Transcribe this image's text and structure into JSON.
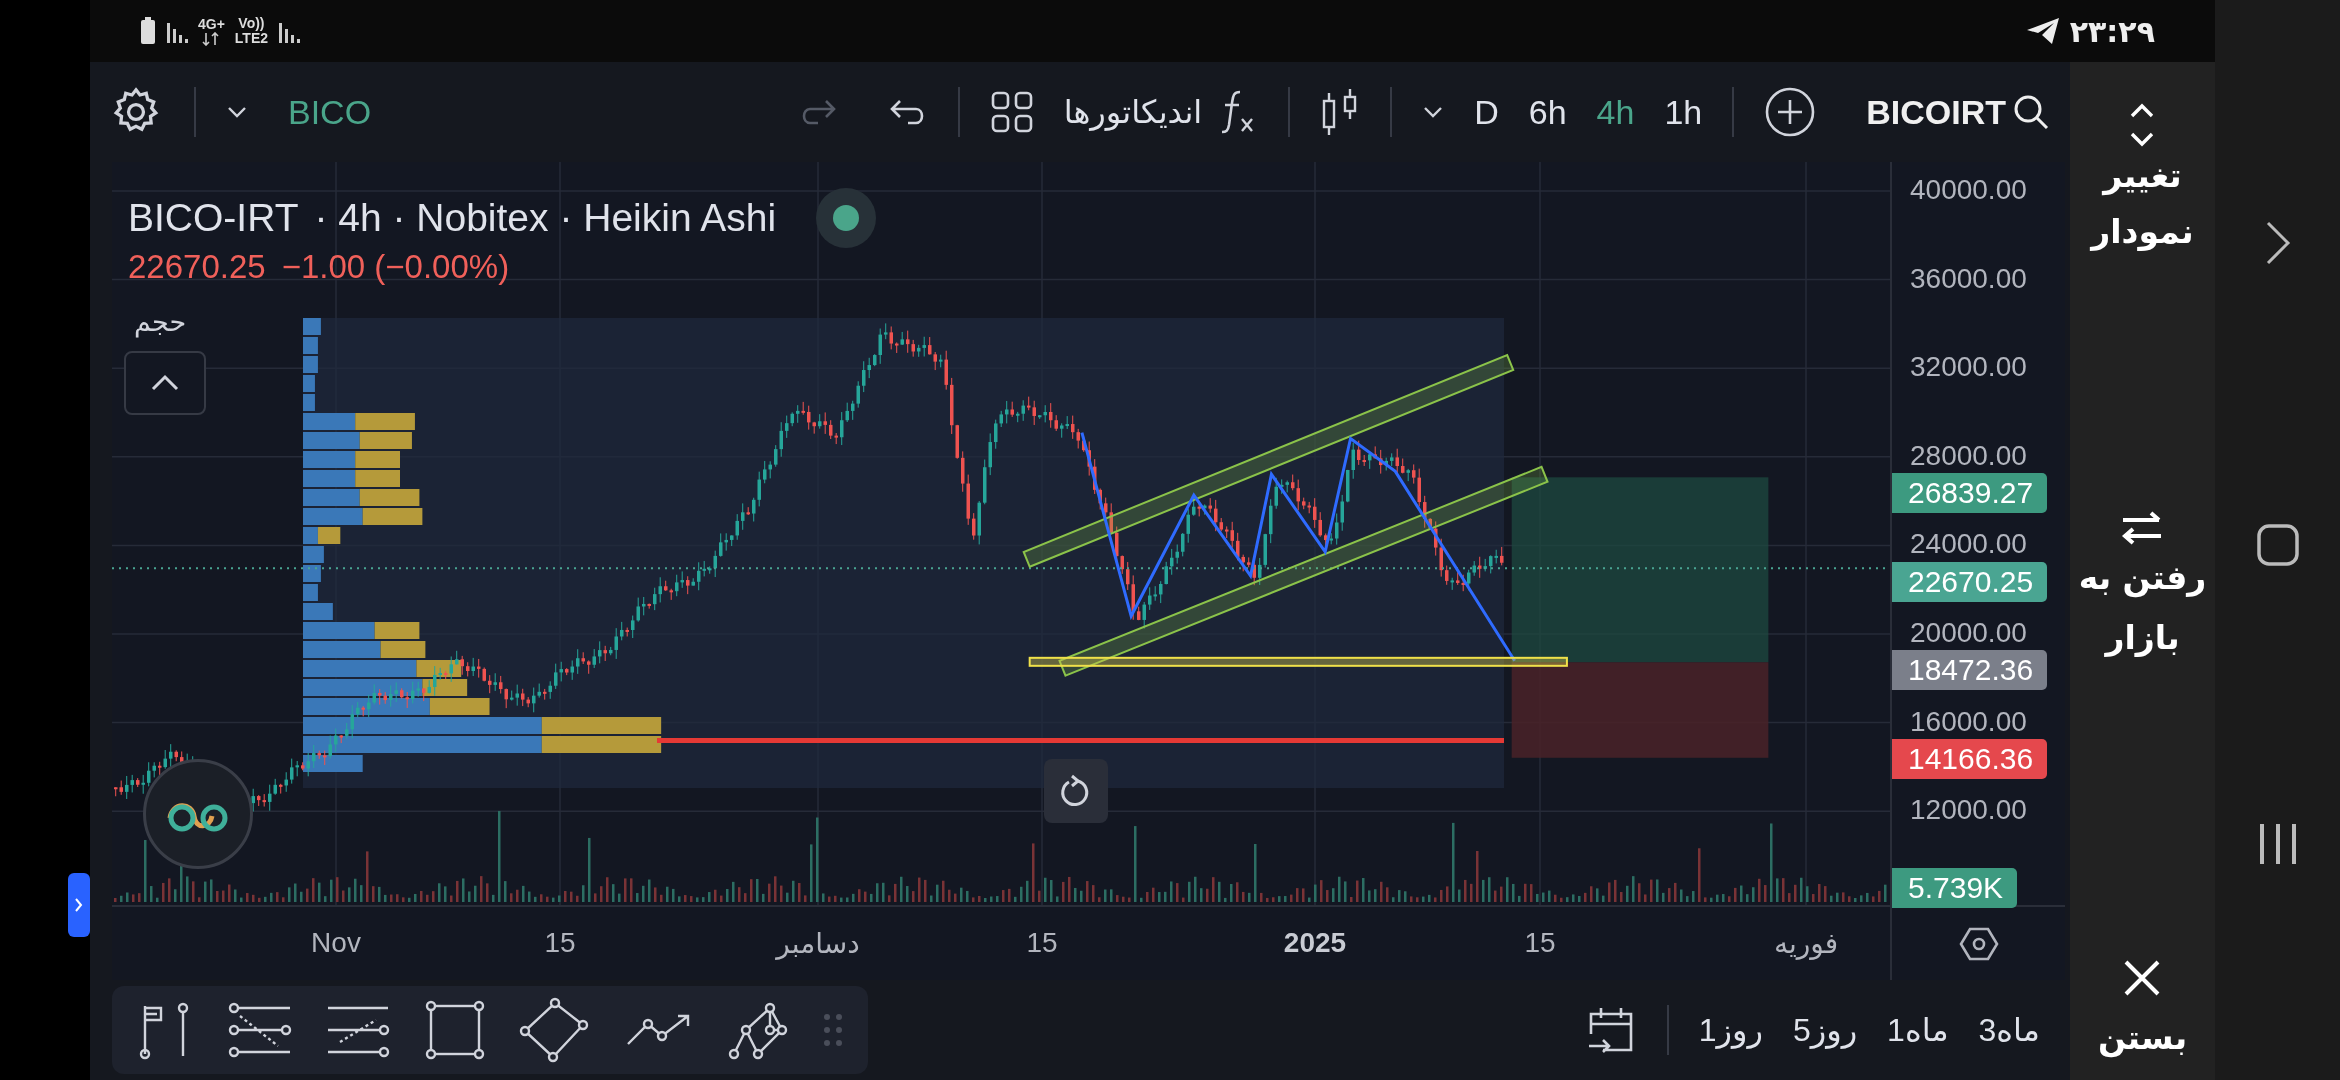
{
  "status_bar": {
    "network_1": "4G+",
    "network_2": "Vo))",
    "network_3": "LTE2",
    "time": "۲۳:۲۹"
  },
  "toolbar": {
    "symbol_short": "BICO",
    "undo": {
      "disabled": false
    },
    "redo": {
      "disabled": true
    },
    "indicators": "اندیکاتورها",
    "intervals": [
      {
        "label": "1h",
        "selected": false
      },
      {
        "label": "4h",
        "selected": true
      },
      {
        "label": "6h",
        "selected": false
      },
      {
        "label": "D",
        "selected": false
      }
    ],
    "symbol": "BICOIRT"
  },
  "chart": {
    "legend": {
      "symbol": "BICO-IRT",
      "details": "· 4h · Nobitex · Heikin Ashi",
      "visible": true,
      "price": "22670.25",
      "change": "−1.00 (−0.00%)"
    },
    "volume_label": "حجم",
    "price_axis": [
      "40000.00",
      "36000.00",
      "32000.00",
      "28000.00",
      "24000.00",
      "20000.00",
      "16000.00",
      "12000.00"
    ],
    "price_badges": [
      {
        "text": "26839.27",
        "color": "#3d9a80"
      },
      {
        "text": "22670.25",
        "color": "#4aa592"
      },
      {
        "text": "18472.36",
        "color": "#7b7f8a"
      },
      {
        "text": "14166.36",
        "color": "#e5484d"
      },
      {
        "text": "5.739K",
        "color": "#3d9a80"
      }
    ],
    "time_axis": [
      {
        "label": "فوریه",
        "bold": false
      },
      {
        "label": "15",
        "bold": false
      },
      {
        "label": "2025",
        "bold": true
      },
      {
        "label": "15",
        "bold": false
      },
      {
        "label": "دسامبر",
        "bold": false
      },
      {
        "label": "15",
        "bold": false
      },
      {
        "label": "Nov",
        "bold": false
      }
    ]
  },
  "bottom_toolbar": {
    "ranges": [
      "3ماه",
      "1ماه",
      "5روز",
      "1روز"
    ]
  },
  "side_panel": {
    "buttons": [
      {
        "kind": "switch",
        "lines": [
          "تغییر",
          "نمودار"
        ]
      },
      {
        "kind": "market",
        "lines": [
          "رفتن به",
          "بازار"
        ]
      },
      {
        "kind": "close",
        "lines": [
          "بستن"
        ]
      }
    ]
  }
}
